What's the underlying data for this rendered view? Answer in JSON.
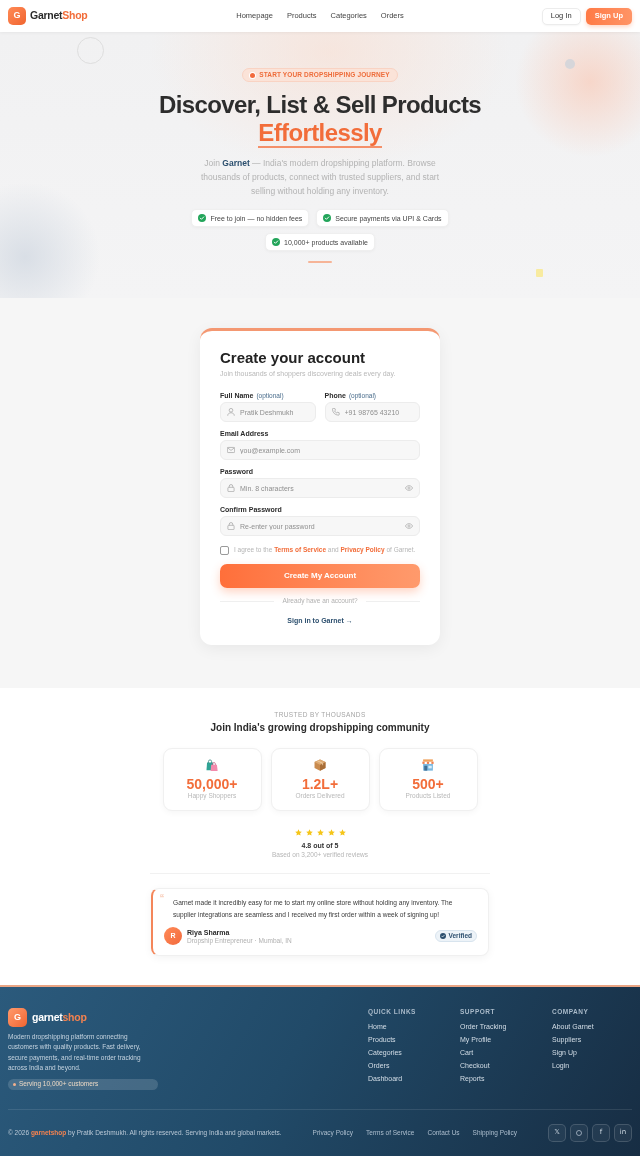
{
  "nav": {
    "logo_mark": "G",
    "brand": "Garnet",
    "brand_accent": "Shop",
    "links": [
      "Homepage",
      "Products",
      "Categories",
      "Orders"
    ],
    "login": "Log In",
    "signup": "Sign Up"
  },
  "hero": {
    "badge": "START YOUR DROPSHIPPING JOURNEY",
    "title": "Discover, List & Sell Products",
    "title_accent": "Effortlessly",
    "intro": "Join **Garnet** — India's modern dropshipping platform. Browse thousands of products, connect with trusted suppliers, and start selling without holding any inventory.",
    "features": [
      "Free to join — no hidden fees",
      "Secure payments via UPI & Cards",
      "10,000+ products available"
    ]
  },
  "signup": {
    "title": "Create your account",
    "subtitle": "Join thousands of shoppers discovering deals every day.",
    "rows": [
      {
        "fields": [
          {
            "kind": "name",
            "label": "Full Name",
            "optional": "(optional)",
            "placeholder": "Pratik Deshmukh"
          },
          {
            "kind": "phone",
            "label": "Phone",
            "optional": "(optional)",
            "placeholder": "+91 98765 43210"
          }
        ]
      },
      {
        "fields": [
          {
            "kind": "email",
            "label": "Email Address",
            "placeholder": "you@example.com"
          }
        ]
      },
      {
        "fields": [
          {
            "kind": "password",
            "label": "Password",
            "placeholder": "Min. 8 characters"
          }
        ]
      },
      {
        "fields": [
          {
            "kind": "password",
            "label": "Confirm Password",
            "placeholder": "Re-enter your password"
          }
        ]
      }
    ],
    "agree": {
      "checked": false,
      "parts": [
        {
          "kind": "text",
          "text": "I agree to the "
        },
        {
          "kind": "link",
          "text": "Terms of Service"
        },
        {
          "kind": "text",
          "text": " and "
        },
        {
          "kind": "link",
          "text": "Privacy Policy"
        },
        {
          "kind": "text",
          "text": " of Garnet."
        }
      ]
    },
    "submit": "Create My Account",
    "divider": "Already have an account?",
    "signin": "Sign in to Garnet →"
  },
  "community": {
    "eyebrow": "TRUSTED BY THOUSANDS",
    "title": "Join India's growing dropshipping community",
    "stats": [
      {
        "kind": "bags",
        "value": "50,000+",
        "label": "Happy Shoppers"
      },
      {
        "kind": "box",
        "value": "1.2L+",
        "label": "Orders Delivered"
      },
      {
        "kind": "store",
        "value": "500+",
        "label": "Products Listed"
      }
    ],
    "rating": {
      "stars": 5,
      "score": "4.8 out of 5",
      "reviews": "Based on 3,200+ verified reviews"
    },
    "testimonial": {
      "quote_mark": "“",
      "text": "Garnet made it incredibly easy for me to start my online store without holding any inventory. The supplier integrations are seamless and I received my first order within a week of signing up!",
      "initial": "R",
      "name": "Riya Sharma",
      "role": "Dropship Entrepreneur · Mumbai, IN",
      "badge": "Verified"
    }
  },
  "footer": {
    "logo_mark": "G",
    "brand": "garnet",
    "brand_accent": "shop",
    "description": "Modern dropshipping platform connecting customers with quality products. Fast delivery, secure payments, and real-time order tracking across India and beyond.",
    "badge": "Serving 10,000+ customers",
    "columns": [
      {
        "title": "QUICK LINKS",
        "links": [
          "Home",
          "Products",
          "Categories",
          "Orders",
          "Dashboard"
        ]
      },
      {
        "title": "SUPPORT",
        "links": [
          "Order Tracking",
          "My Profile",
          "Cart",
          "Checkout",
          "Reports"
        ]
      },
      {
        "title": "COMPANY",
        "links": [
          "About Garnet",
          "Suppliers",
          "Sign Up",
          "Login"
        ]
      }
    ],
    "copyright": "© 2026 **garnetshop** by Pratik Deshmukh. All rights reserved. Serving India and global markets.",
    "legal_links": [
      "Privacy Policy",
      "Terms of Service",
      "Contact Us",
      "Shipping Policy"
    ],
    "social": [
      {
        "kind": "text",
        "label": "𝕏"
      },
      {
        "kind": "ring"
      },
      {
        "kind": "text",
        "label": "f"
      },
      {
        "kind": "text",
        "label": "in"
      }
    ]
  }
}
